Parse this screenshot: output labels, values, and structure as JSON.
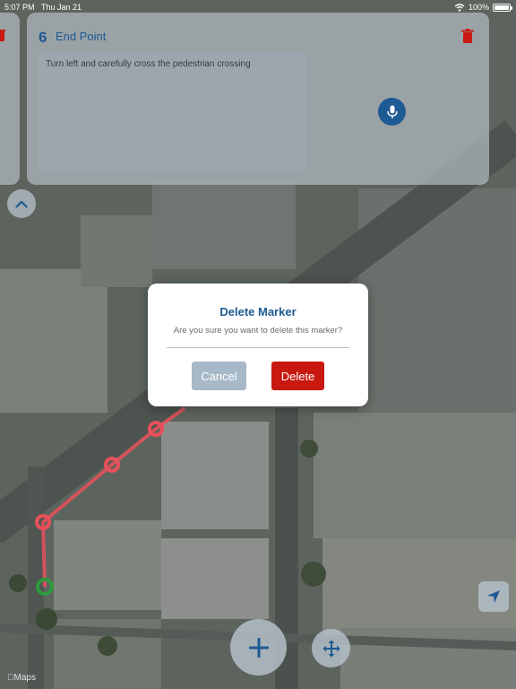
{
  "status_bar": {
    "time": "5:07 PM",
    "date": "Thu Jan 21",
    "battery": "100%",
    "wifi_icon": "wifi-icon"
  },
  "marker_card": {
    "number": "6",
    "title": "End Point",
    "note": "Turn left and carefully cross the pedestrian crossing",
    "delete_icon": "trash-icon",
    "mic_icon": "microphone-icon"
  },
  "collapse_icon": "chevron-up-icon",
  "dialog": {
    "title": "Delete Marker",
    "message": "Are you sure you want to delete this marker?",
    "cancel_label": "Cancel",
    "delete_label": "Delete"
  },
  "map_controls": {
    "locate_icon": "location-arrow-icon",
    "add_icon": "plus-icon",
    "move_icon": "move-icon"
  },
  "map_attribution": "Maps",
  "colors": {
    "accent": "#1e5a93",
    "danger": "#c8180f",
    "route": "#e8505a",
    "start_marker": "#2e9b3e"
  }
}
